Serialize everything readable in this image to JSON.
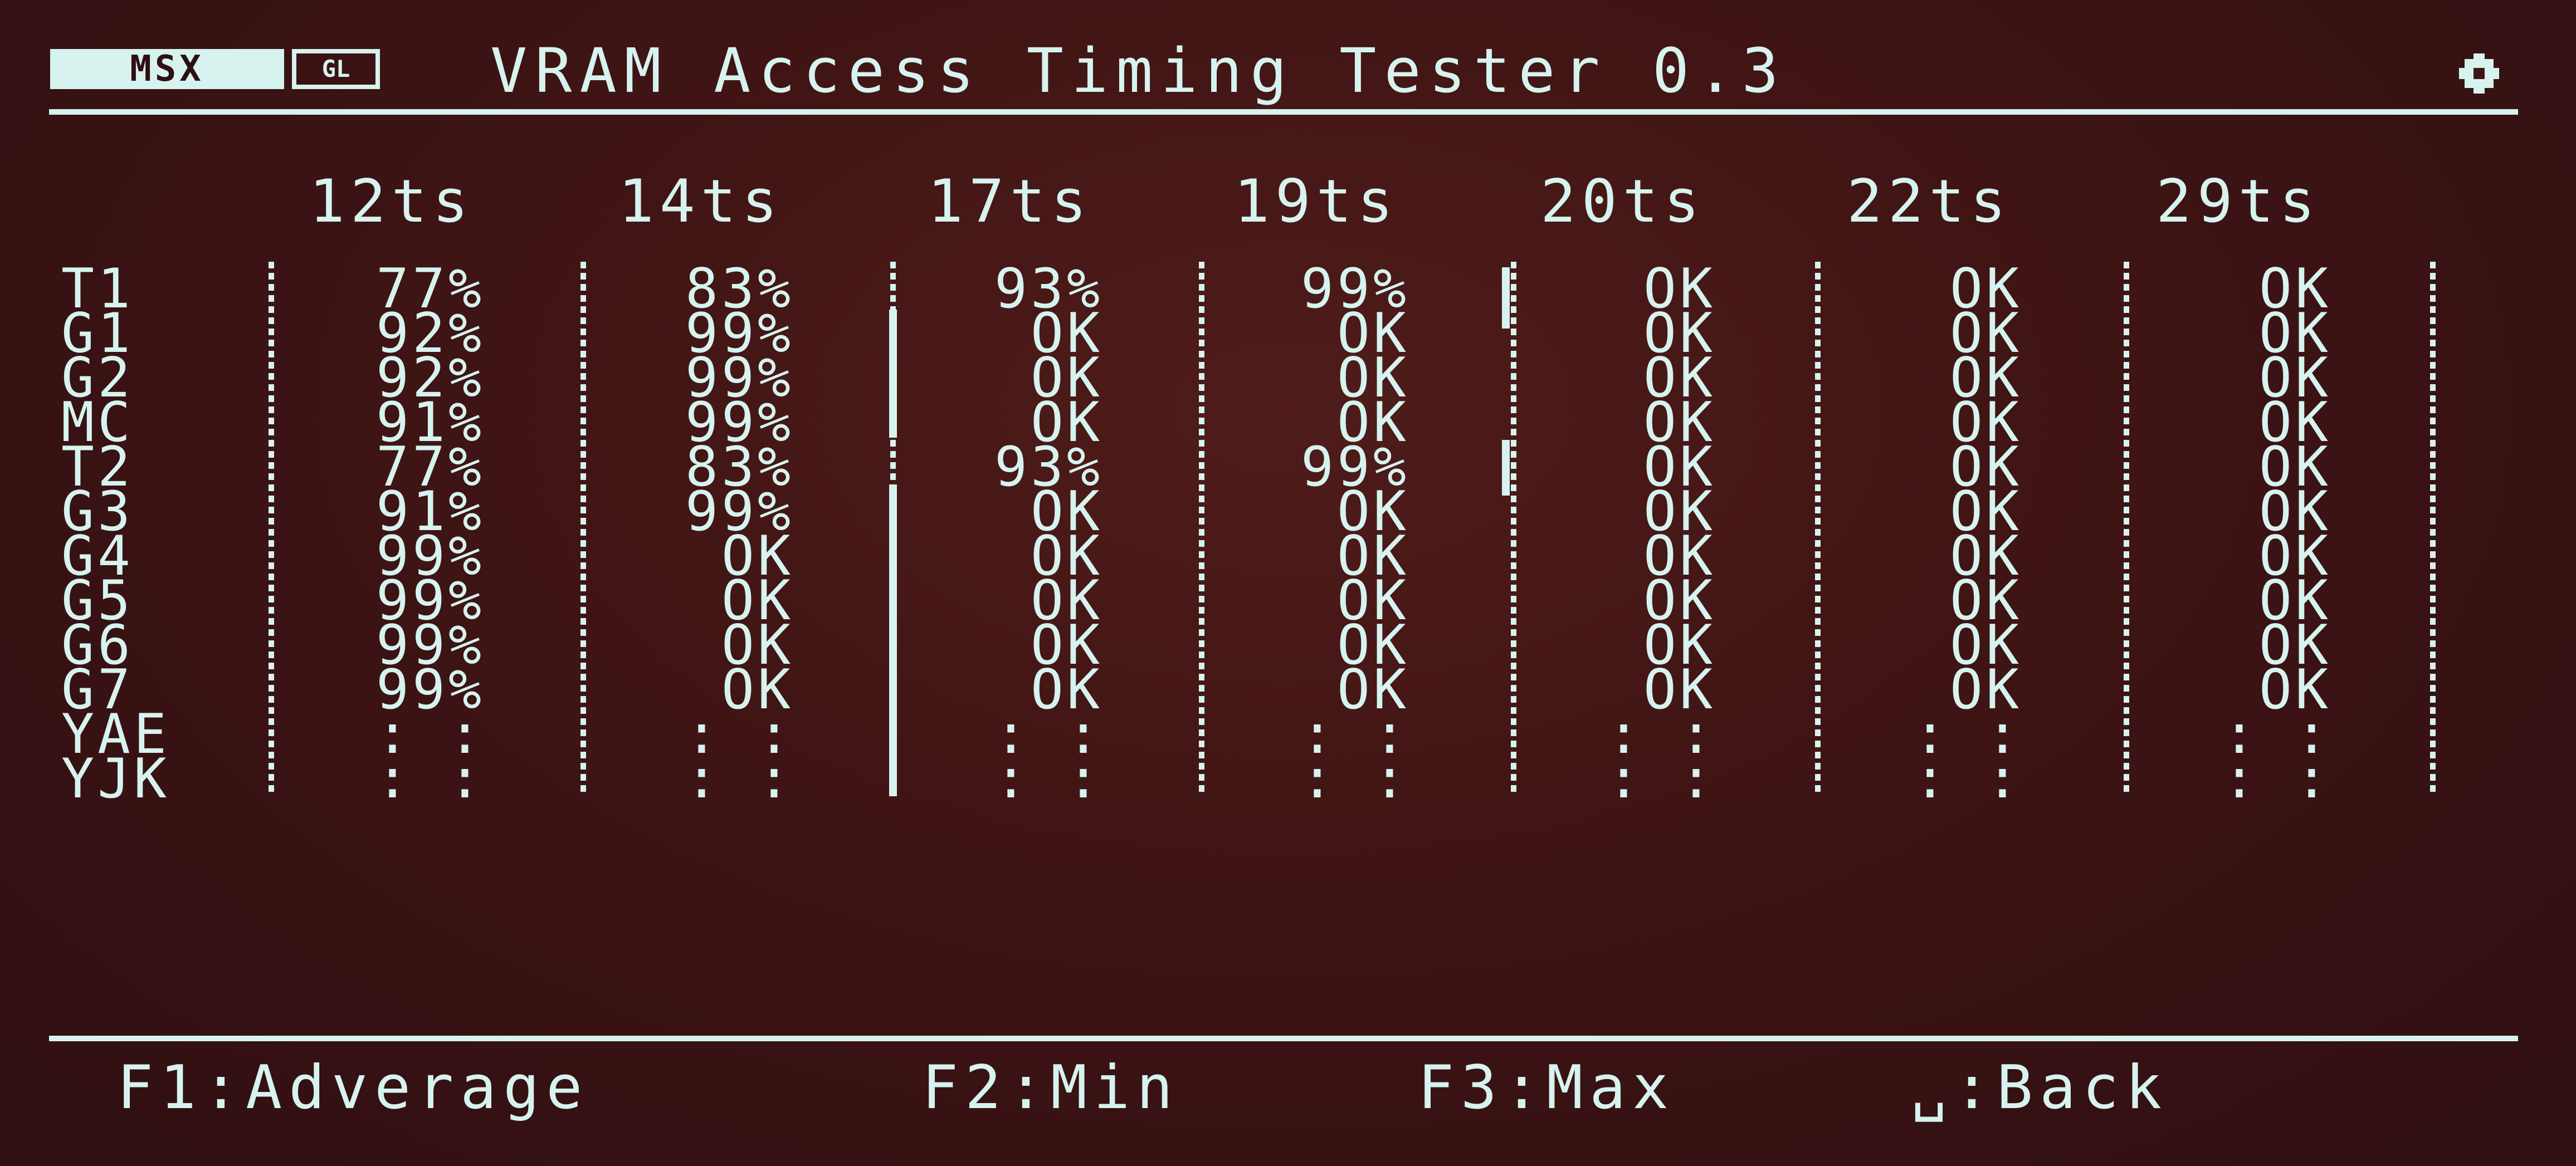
{
  "header": {
    "logo_text": "MSX",
    "logo_sub": "GL",
    "title": "VRAM Access Timing Tester 0.3",
    "settings_icon": "gear-icon"
  },
  "columns": [
    "12ts",
    "14ts",
    "17ts",
    "19ts",
    "20ts",
    "22ts",
    "29ts"
  ],
  "rows": [
    {
      "mode": "T1",
      "values": [
        "77%",
        "83%",
        "93%",
        "99%",
        "OK",
        "OK",
        "OK"
      ]
    },
    {
      "mode": "G1",
      "values": [
        "92%",
        "99%",
        "OK",
        "OK",
        "OK",
        "OK",
        "OK"
      ]
    },
    {
      "mode": "G2",
      "values": [
        "92%",
        "99%",
        "OK",
        "OK",
        "OK",
        "OK",
        "OK"
      ]
    },
    {
      "mode": "MC",
      "values": [
        "91%",
        "99%",
        "OK",
        "OK",
        "OK",
        "OK",
        "OK"
      ]
    },
    {
      "mode": "T2",
      "values": [
        "77%",
        "83%",
        "93%",
        "99%",
        "OK",
        "OK",
        "OK"
      ]
    },
    {
      "mode": "G3",
      "values": [
        "91%",
        "99%",
        "OK",
        "OK",
        "OK",
        "OK",
        "OK"
      ]
    },
    {
      "mode": "G4",
      "values": [
        "99%",
        "OK",
        "OK",
        "OK",
        "OK",
        "OK",
        "OK"
      ]
    },
    {
      "mode": "G5",
      "values": [
        "99%",
        "OK",
        "OK",
        "OK",
        "OK",
        "OK",
        "OK"
      ]
    },
    {
      "mode": "G6",
      "values": [
        "99%",
        "OK",
        "OK",
        "OK",
        "OK",
        "OK",
        "OK"
      ]
    },
    {
      "mode": "G7",
      "values": [
        "99%",
        "OK",
        "OK",
        "OK",
        "OK",
        "OK",
        "OK"
      ]
    },
    {
      "mode": "YAE",
      "values": [
        ": :",
        ": :",
        ": :",
        ": :",
        ": :",
        ": :",
        ": :"
      ]
    },
    {
      "mode": "YJK",
      "values": [
        ": :",
        ": :",
        ": :",
        ": :",
        ": :",
        ": :",
        ": :"
      ]
    }
  ],
  "footer": {
    "f1": "F1:Adverage",
    "f2": "F2:Min",
    "f3": "F3:Max",
    "back": "␣:Back"
  },
  "colors": {
    "foreground": "#d6f3ef",
    "background": "#3f1414"
  }
}
